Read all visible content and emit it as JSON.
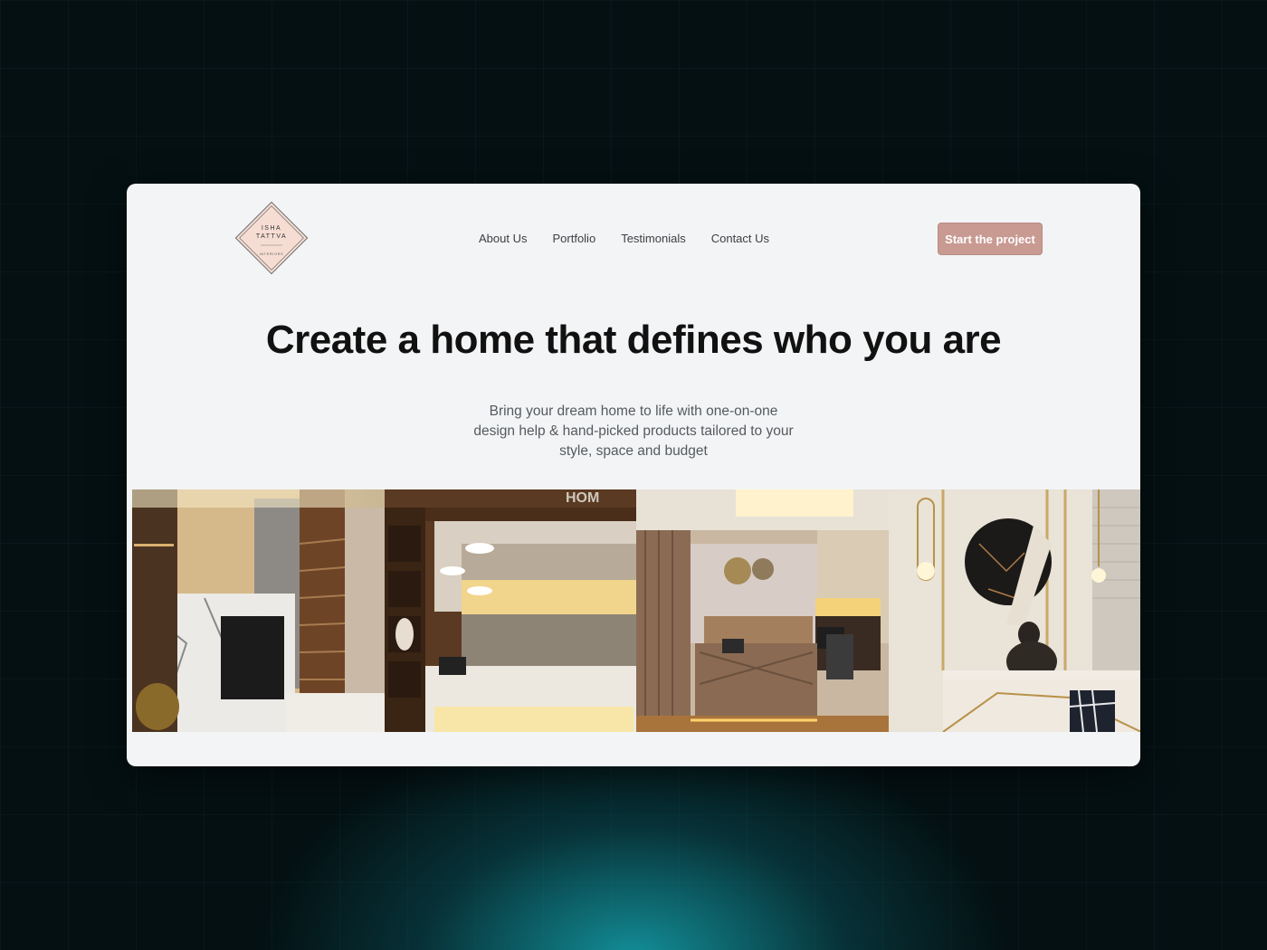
{
  "brand": {
    "line1": "ISHA",
    "line2": "TATTVA",
    "tagline": "INTERIORS"
  },
  "nav": {
    "items": [
      "About Us",
      "Portfolio",
      "Testimonials",
      "Contact Us"
    ]
  },
  "cta": {
    "label": "Start the project"
  },
  "hero": {
    "title": "Create a home that defines who you are",
    "subtitle": "Bring your dream home to life with one-on-one design help & hand-picked products tailored to your style, space and budget"
  },
  "gallery": {
    "photos": [
      {
        "subject": "living-room-tv-wall"
      },
      {
        "subject": "kitchen"
      },
      {
        "subject": "bedroom"
      },
      {
        "subject": "buddha-decor-wall"
      }
    ]
  },
  "colors": {
    "card_bg": "#f3f4f5",
    "cta_bg": "#c99a92",
    "logo_fill": "#f6ddd3",
    "page_bg": "#041012",
    "glow": "#14a0aa"
  }
}
